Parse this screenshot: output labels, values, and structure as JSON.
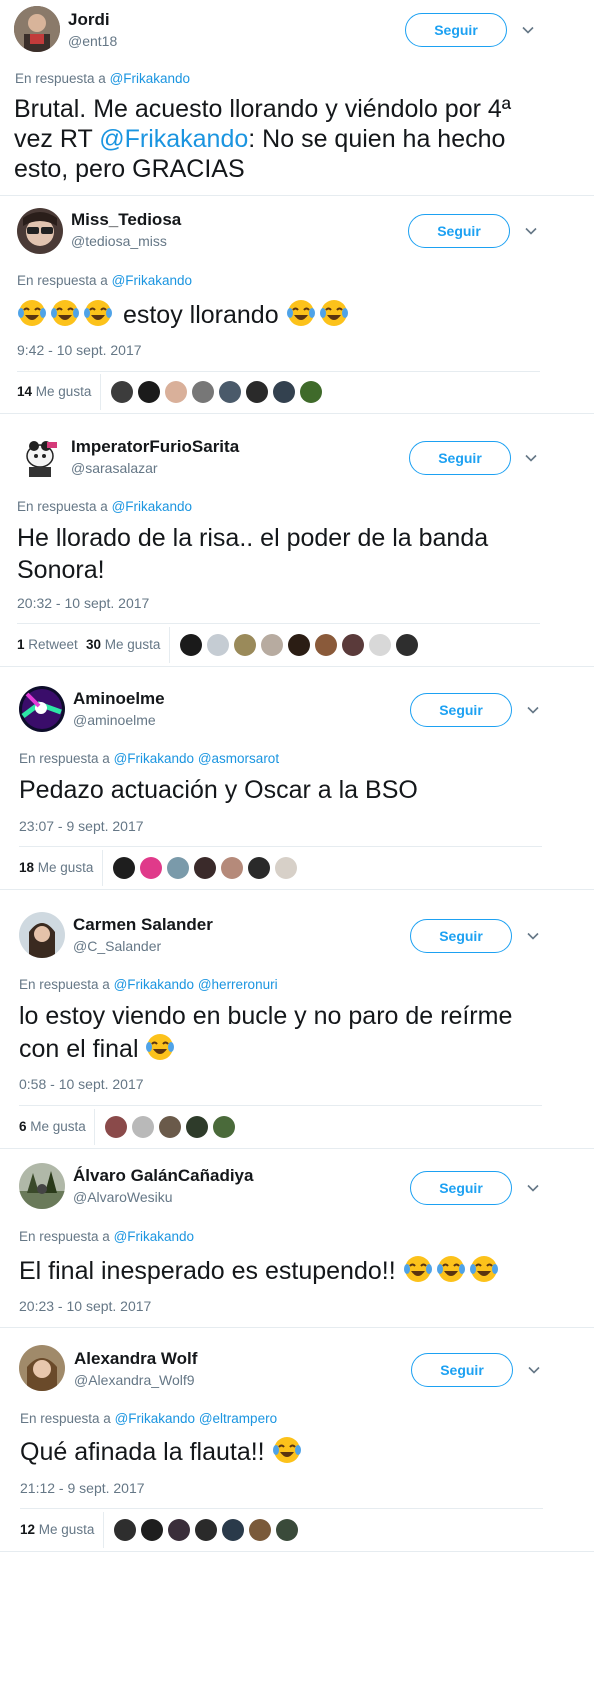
{
  "follow_label": "Seguir",
  "tweets": [
    {
      "name": "Jordi",
      "handle": "@ent18",
      "reply_prefix": "En respuesta a",
      "reply_to": "@Frikakando",
      "reply_to_2": "",
      "text_a": "Brutal. Me acuesto llorando y viéndolo por 4ª vez RT ",
      "text_link": "@Frikakando",
      "text_b": ": No se quien ha hecho esto, pero GRACIAS",
      "timestamp": "",
      "retweets": "",
      "retweets_label": "",
      "likes": "",
      "likes_label": ""
    },
    {
      "name": "Miss_Tediosa",
      "handle": "@tediosa_miss",
      "reply_prefix": "En respuesta a",
      "reply_to": "@Frikakando",
      "reply_to_2": "",
      "text_a": "estoy llorando",
      "timestamp": "9:42 - 10 sept. 2017",
      "retweets": "",
      "retweets_label": "",
      "likes": "14",
      "likes_label": "Me gusta"
    },
    {
      "name": "ImperatorFurioSarita",
      "handle": "@sarasalazar",
      "reply_prefix": "En respuesta a",
      "reply_to": "@Frikakando",
      "reply_to_2": "",
      "text_a": "He llorado de la risa.. el poder de la banda Sonora!",
      "timestamp": "20:32 - 10 sept. 2017",
      "retweets": "1",
      "retweets_label": "Retweet",
      "likes": "30",
      "likes_label": "Me gusta"
    },
    {
      "name": "Aminoelme",
      "handle": "@aminoelme",
      "reply_prefix": "En respuesta a",
      "reply_to": "@Frikakando",
      "reply_to_2": "@asmorsarot",
      "text_a": "Pedazo actuación y Oscar a la BSO",
      "timestamp": "23:07 - 9 sept. 2017",
      "retweets": "",
      "retweets_label": "",
      "likes": "18",
      "likes_label": "Me gusta"
    },
    {
      "name": "Carmen Salander",
      "handle": "@C_Salander",
      "reply_prefix": "En respuesta a",
      "reply_to": "@Frikakando",
      "reply_to_2": "@herreronuri",
      "text_a": "lo estoy viendo en bucle y no paro de reírme con el final",
      "timestamp": "0:58 - 10 sept. 2017",
      "retweets": "",
      "retweets_label": "",
      "likes": "6",
      "likes_label": "Me gusta"
    },
    {
      "name": "Álvaro GalánCañadiya",
      "handle": "@AlvaroWesiku",
      "reply_prefix": "En respuesta a",
      "reply_to": "@Frikakando",
      "reply_to_2": "",
      "text_a": "El final inesperado es estupendo!!",
      "timestamp": "20:23 - 10 sept. 2017",
      "retweets": "",
      "retweets_label": "",
      "likes": "",
      "likes_label": ""
    },
    {
      "name": "Alexandra Wolf",
      "handle": "@Alexandra_Wolf9",
      "reply_prefix": "En respuesta a",
      "reply_to": "@Frikakando",
      "reply_to_2": "@eltrampero",
      "text_a": "Qué afinada la flauta!!",
      "timestamp": "21:12 - 9 sept. 2017",
      "retweets": "",
      "retweets_label": "",
      "likes": "12",
      "likes_label": "Me gusta"
    }
  ],
  "colors": {
    "link": "#1b95e0",
    "follow_border": "#1da1f2",
    "muted": "#657786",
    "divider": "#e6ecf0"
  },
  "icons": {
    "emoji": "face-with-tears-of-joy-icon",
    "menu": "chevron-down-icon"
  }
}
